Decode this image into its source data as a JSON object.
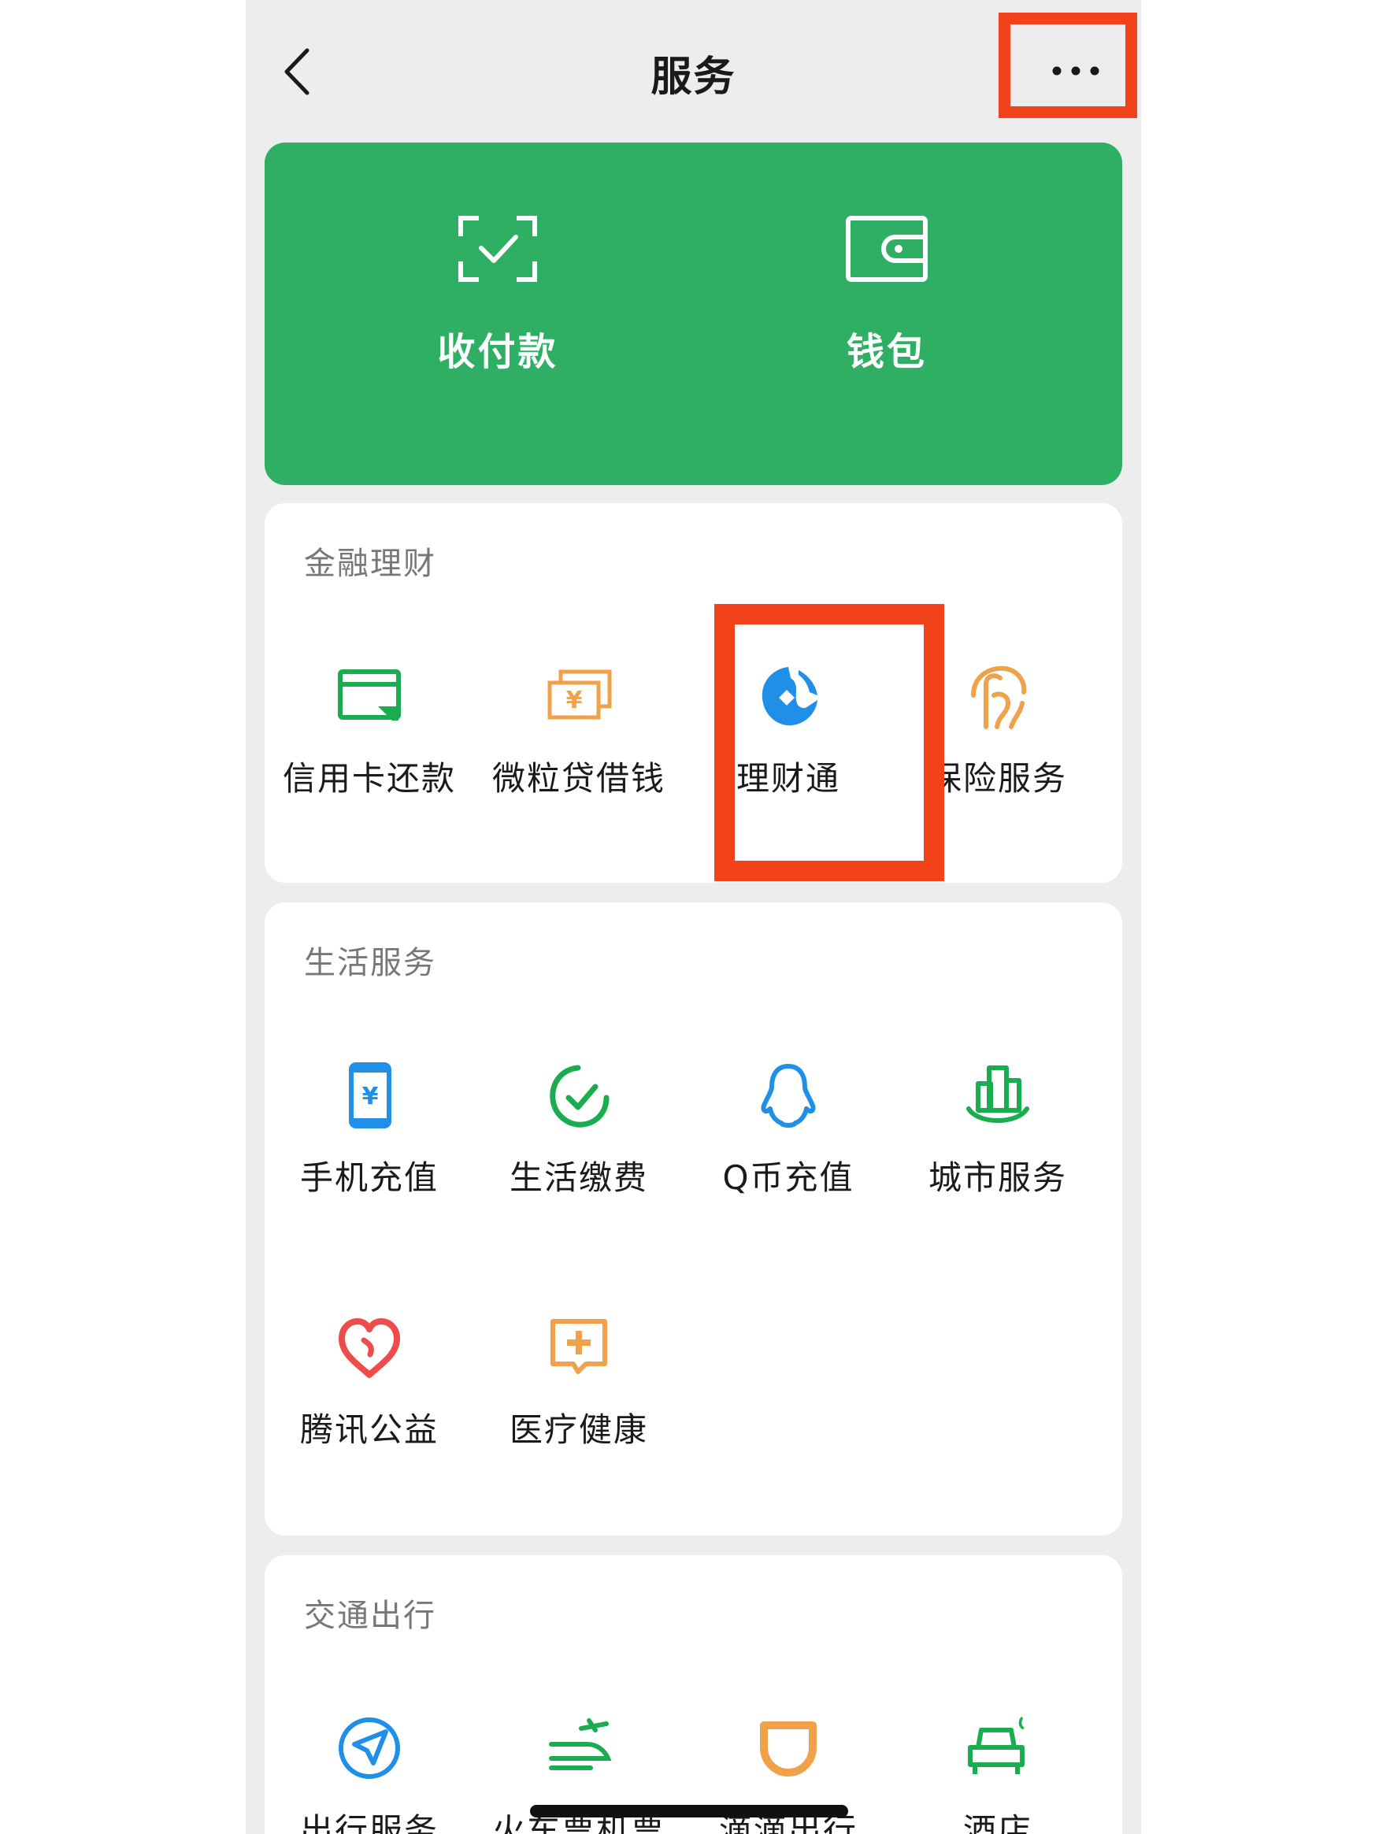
{
  "nav": {
    "title": "服务",
    "back_icon": "chevron-left-icon",
    "more_icon": "more-dots-icon"
  },
  "wallet_card": {
    "color": "#2eaf64",
    "items": [
      {
        "label": "收付款",
        "icon": "scan-check-icon"
      },
      {
        "label": "钱包",
        "icon": "wallet-icon"
      }
    ]
  },
  "sections": [
    {
      "title": "金融理财",
      "items": [
        {
          "label": "信用卡还款",
          "icon": "credit-card-icon"
        },
        {
          "label": "微粒贷借钱",
          "icon": "loan-money-icon"
        },
        {
          "label": "理财通",
          "icon": "wealth-drop-icon"
        },
        {
          "label": "保险服务",
          "icon": "insurance-umbrella-icon"
        }
      ]
    },
    {
      "title": "生活服务",
      "items": [
        {
          "label": "手机充值",
          "icon": "phone-recharge-icon"
        },
        {
          "label": "生活缴费",
          "icon": "bill-check-icon"
        },
        {
          "label": "Q币充值",
          "icon": "qq-penguin-icon"
        },
        {
          "label": "城市服务",
          "icon": "city-buildings-icon"
        },
        {
          "label": "腾讯公益",
          "icon": "charity-heart-icon"
        },
        {
          "label": "医疗健康",
          "icon": "medical-cross-icon"
        }
      ]
    },
    {
      "title": "交通出行",
      "items": [
        {
          "label": "出行服务",
          "icon": "navigation-arrow-icon"
        },
        {
          "label": "火车票机票",
          "icon": "train-plane-icon"
        },
        {
          "label": "滴滴出行",
          "icon": "didi-icon"
        },
        {
          "label": "酒店",
          "icon": "hotel-bed-icon"
        }
      ]
    }
  ],
  "colors": {
    "highlight": "#f2421b",
    "green": "#1aad4f",
    "orange": "#f0a24a",
    "blue": "#1f8fe8",
    "red": "#ee4b4b"
  }
}
